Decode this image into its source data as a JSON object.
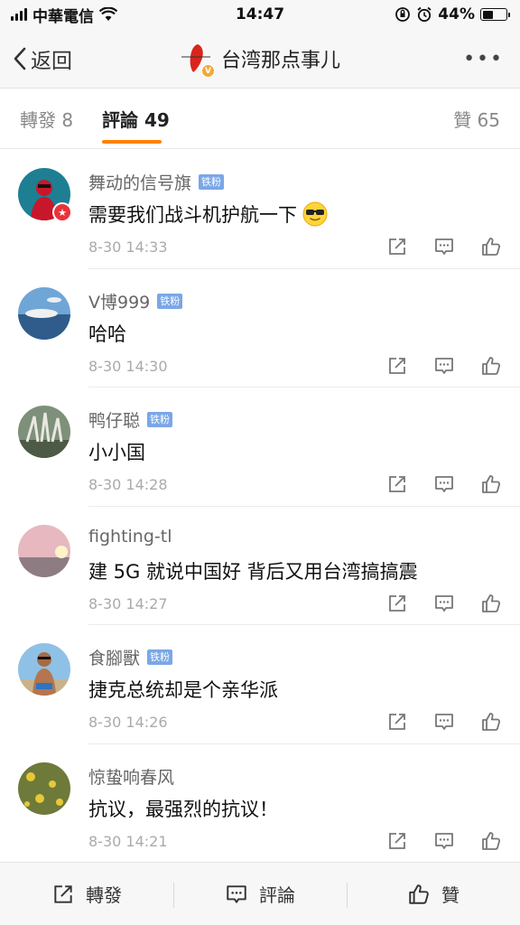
{
  "status_bar": {
    "carrier": "中華電信",
    "time": "14:47",
    "battery": "44%",
    "battery_level": 0.44
  },
  "nav": {
    "back_label": "返回",
    "title": "台湾那点事儿",
    "more_label": "•••"
  },
  "tabs": {
    "repost": "轉發 8",
    "comments": "評論 49",
    "likes": "贊 65"
  },
  "comments": [
    {
      "name": "舞动的信号旗",
      "badge": "铁粉",
      "text": "需要我们战斗机护航一下",
      "time": "8-30 14:33"
    },
    {
      "name": "V博999",
      "badge": "铁粉",
      "text": "哈哈",
      "time": "8-30 14:30"
    },
    {
      "name": "鸭仔聪",
      "badge": "铁粉",
      "text": "小小国",
      "time": "8-30 14:28"
    },
    {
      "name": "fighting-tl",
      "badge": "",
      "text": "建 5G 就说中国好 背后又用台湾搞搞震",
      "time": "8-30 14:27"
    },
    {
      "name": "食腳獸",
      "badge": "铁粉",
      "text": "捷克总统却是个亲华派",
      "time": "8-30 14:26"
    },
    {
      "name": "惊蛰响春风",
      "badge": "",
      "text": "抗议，最强烈的抗议！",
      "time": "8-30 14:21"
    }
  ],
  "bottom_bar": {
    "repost": "轉發",
    "comment": "評論",
    "like": "贊"
  },
  "colors": {
    "accent": "#ff8200",
    "fan_badge": "#7aa7e6"
  }
}
